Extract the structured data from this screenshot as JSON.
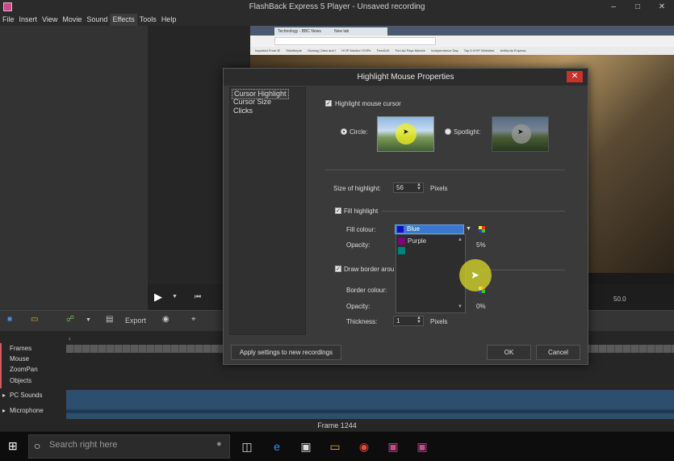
{
  "window": {
    "title": "FlashBack Express 5 Player - Unsaved recording"
  },
  "menu": [
    "File",
    "Insert",
    "View",
    "Movie",
    "Sound",
    "Effects",
    "Tools",
    "Help"
  ],
  "menu_active": "Effects",
  "browser": {
    "tabs": [
      "Technology - BBC News",
      "New tab"
    ],
    "bookmarks": [
      "Imported From IE",
      "Slicethepie",
      "Gizmag | New and I",
      "HYIP Monitor HYIPe",
      "Feed140",
      "Fort Ad Pays Membe",
      "Independence Day",
      "Top 5 HYIP Websites",
      "AdWords Express"
    ]
  },
  "timeline": {
    "time_value": "50.0"
  },
  "toolbar": {
    "export_label": "Export"
  },
  "tracks": {
    "labels": [
      "Frames",
      "Mouse",
      "ZoomPan",
      "Objects"
    ],
    "audio": [
      "PC Sounds",
      "Microphone"
    ],
    "frame_label": "Frame 1244"
  },
  "taskbar": {
    "search_placeholder": "Search right here"
  },
  "dialog": {
    "title": "Highlight Mouse Properties",
    "categories": [
      "Cursor Highlight",
      "Cursor Size",
      "Clicks"
    ],
    "highlight_mouse_cursor": "Highlight mouse cursor",
    "circle_label": "Circle:",
    "spotlight_label": "Spotlight:",
    "size_label": "Size of highlight:",
    "size_value": "56",
    "size_unit": "Pixels",
    "fill_highlight": "Fill highlight",
    "fill_colour_label": "Fill colour:",
    "fill_colour_value": "Blue",
    "fill_options": [
      {
        "name": "Purple",
        "color": "#800080"
      },
      {
        "name": "",
        "color": "#008080"
      }
    ],
    "opacity_label": "Opacity:",
    "opacity_value_partial": "5%",
    "draw_border": "Draw border arou",
    "border_colour_label": "Border colour:",
    "border_opacity_partial": "0%",
    "thickness_label": "Thickness:",
    "thickness_value": "1",
    "thickness_unit": "Pixels",
    "apply_button": "Apply settings to new recordings",
    "ok_button": "OK",
    "cancel_button": "Cancel"
  },
  "colors": {
    "accent": "#3b76d0",
    "close": "#c9312c",
    "highlight": "#e6e628"
  }
}
